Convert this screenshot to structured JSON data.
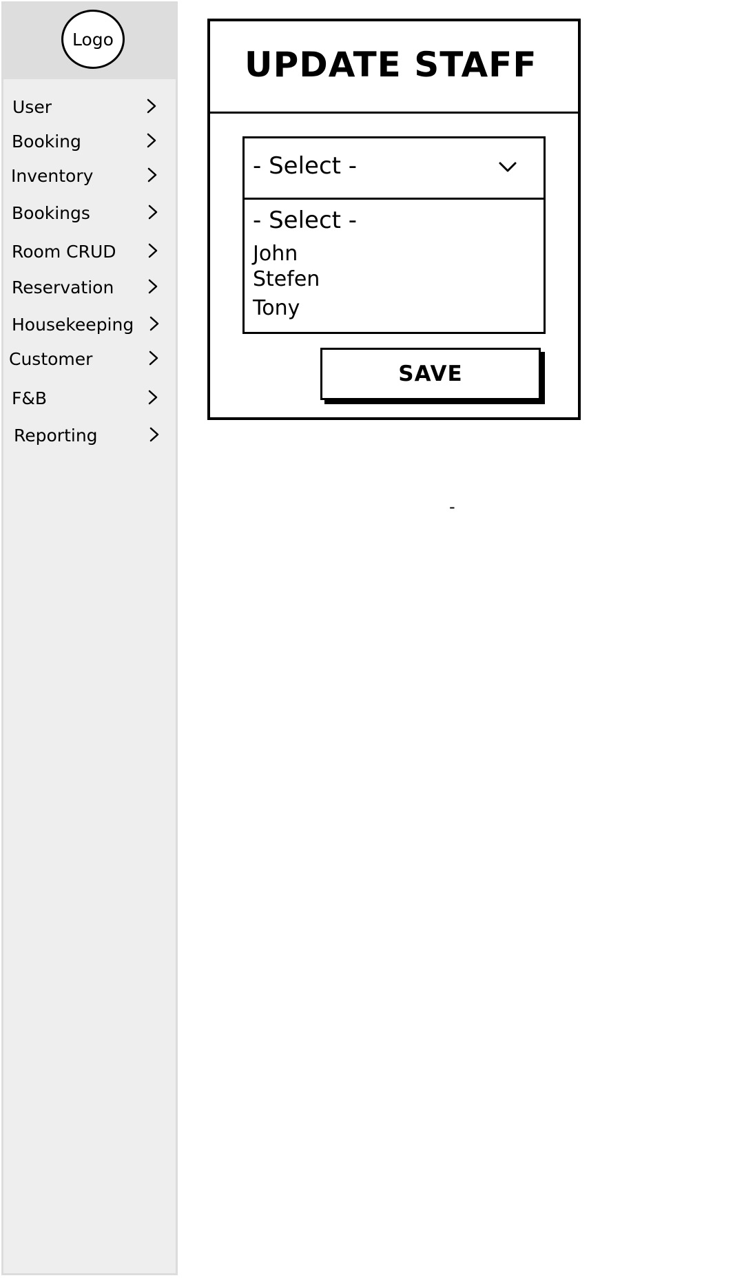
{
  "sidebar": {
    "logo_text": "Logo",
    "items": [
      {
        "label": "User"
      },
      {
        "label": "Booking"
      },
      {
        "label": "Inventory"
      },
      {
        "label": "Bookings"
      },
      {
        "label": "Room CRUD"
      },
      {
        "label": "Reservation"
      },
      {
        "label": "Housekeeping"
      },
      {
        "label": "Customer"
      },
      {
        "label": "F&B"
      },
      {
        "label": "Reporting"
      }
    ]
  },
  "panel": {
    "title": "UPDATE STAFF",
    "select": {
      "value": "- Select -",
      "options": [
        "- Select -",
        "John",
        "Stefen",
        "Tony"
      ]
    },
    "save_label": "SAVE"
  },
  "stray_text": "-"
}
